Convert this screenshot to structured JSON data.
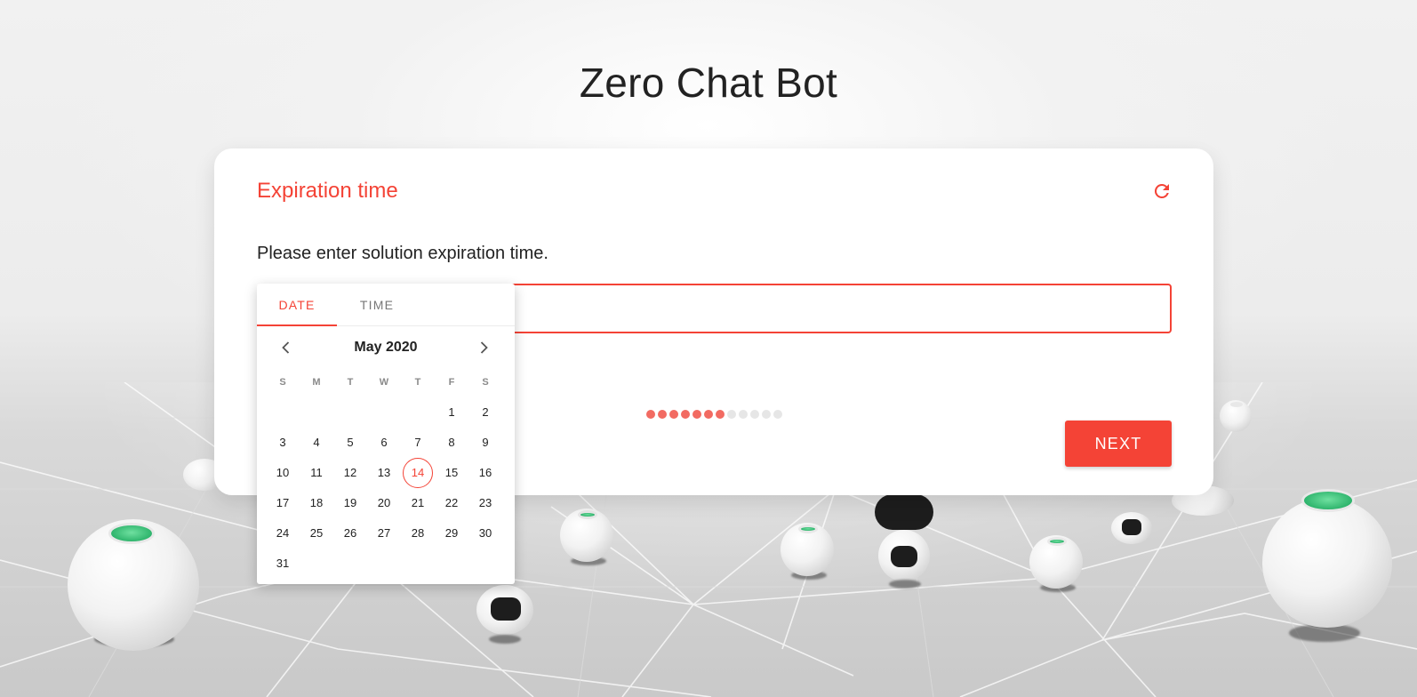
{
  "app": {
    "title": "Zero Chat Bot"
  },
  "card": {
    "title": "Expiration time",
    "refresh_icon": "refresh-icon",
    "prompt": "Please enter solution expiration time.",
    "input_value": "",
    "progress": {
      "completed": 7,
      "total": 12
    },
    "next_label": "NEXT"
  },
  "picker": {
    "tabs": [
      {
        "label": "DATE"
      },
      {
        "label": "TIME"
      }
    ],
    "active_tab": "DATE",
    "month_label": "May 2020",
    "weekdays": [
      "S",
      "M",
      "T",
      "W",
      "T",
      "F",
      "S"
    ],
    "first_weekday_index": 5,
    "days_in_month": 31,
    "selected_day": 14
  },
  "colors": {
    "accent": "#f44336",
    "progress_on": "#f26b62",
    "progress_off": "#e6e6e6"
  }
}
